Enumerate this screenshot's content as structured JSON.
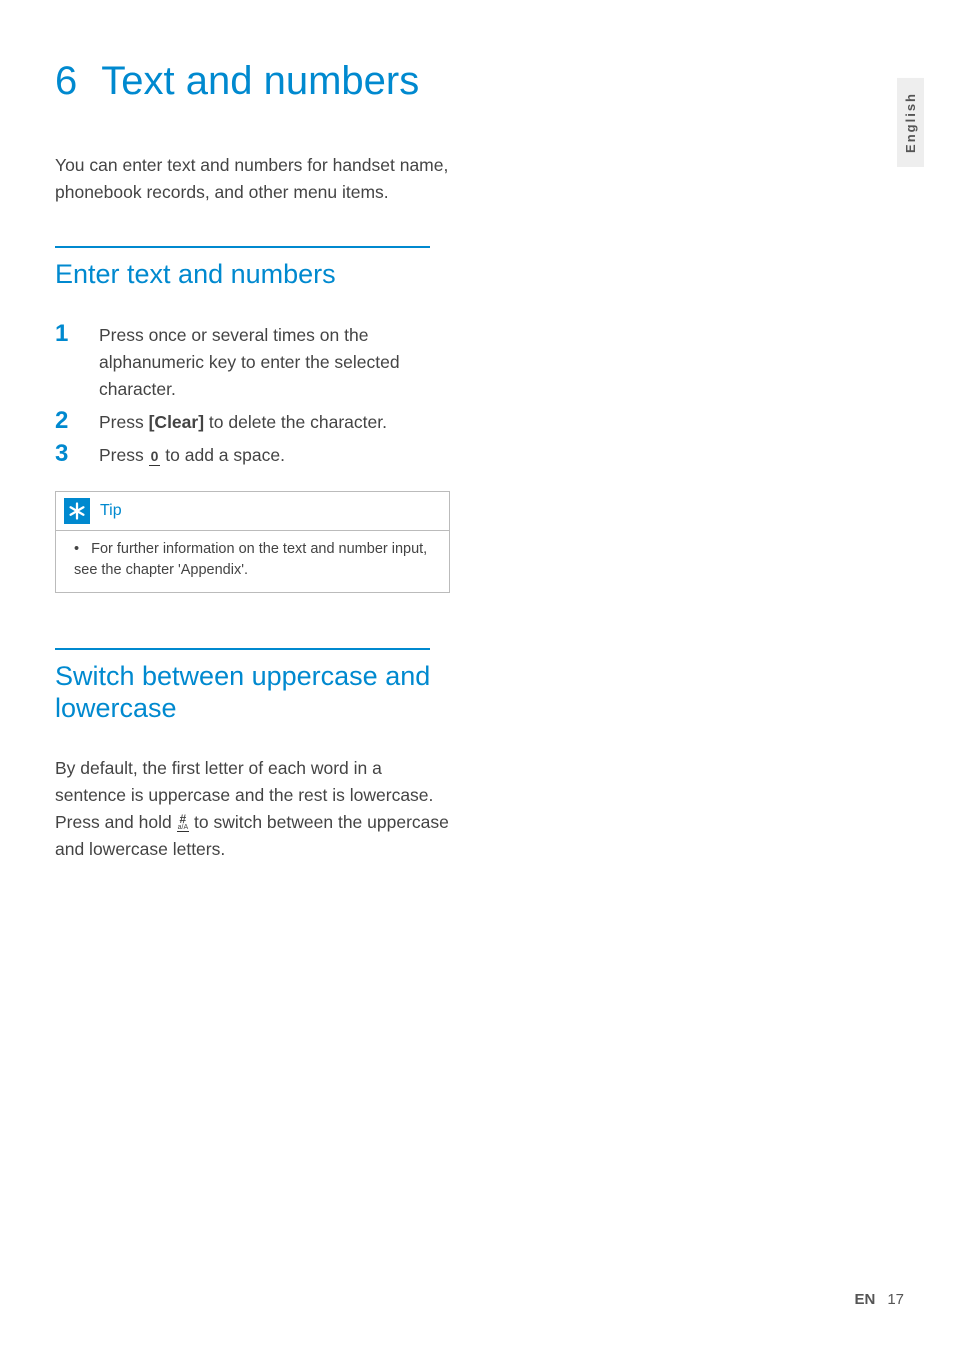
{
  "chapter": {
    "number": "6",
    "title": "Text and numbers"
  },
  "intro": "You can enter text and numbers for handset name, phonebook records, and other menu items.",
  "section1": {
    "title": "Enter text and numbers",
    "steps": [
      {
        "num": "1",
        "text_a": "Press once or several times on the alphanumeric key to enter the selected character."
      },
      {
        "num": "2",
        "text_a": "Press ",
        "bold": "[Clear]",
        "text_b": " to delete the character."
      },
      {
        "num": "3",
        "text_a": "Press ",
        "icon": "0",
        "text_b": " to add a space."
      }
    ]
  },
  "tip": {
    "label": "Tip",
    "body": "For further information on the text and number input, see the chapter 'Appendix'."
  },
  "section2": {
    "title": "Switch between uppercase and lowercase",
    "para_a": "By default, the first letter of each word in a sentence is uppercase and the rest is lowercase. Press and hold ",
    "para_b": " to switch between the uppercase and lowercase letters."
  },
  "sideTab": "English",
  "footer": {
    "lang": "EN",
    "page": "17"
  }
}
